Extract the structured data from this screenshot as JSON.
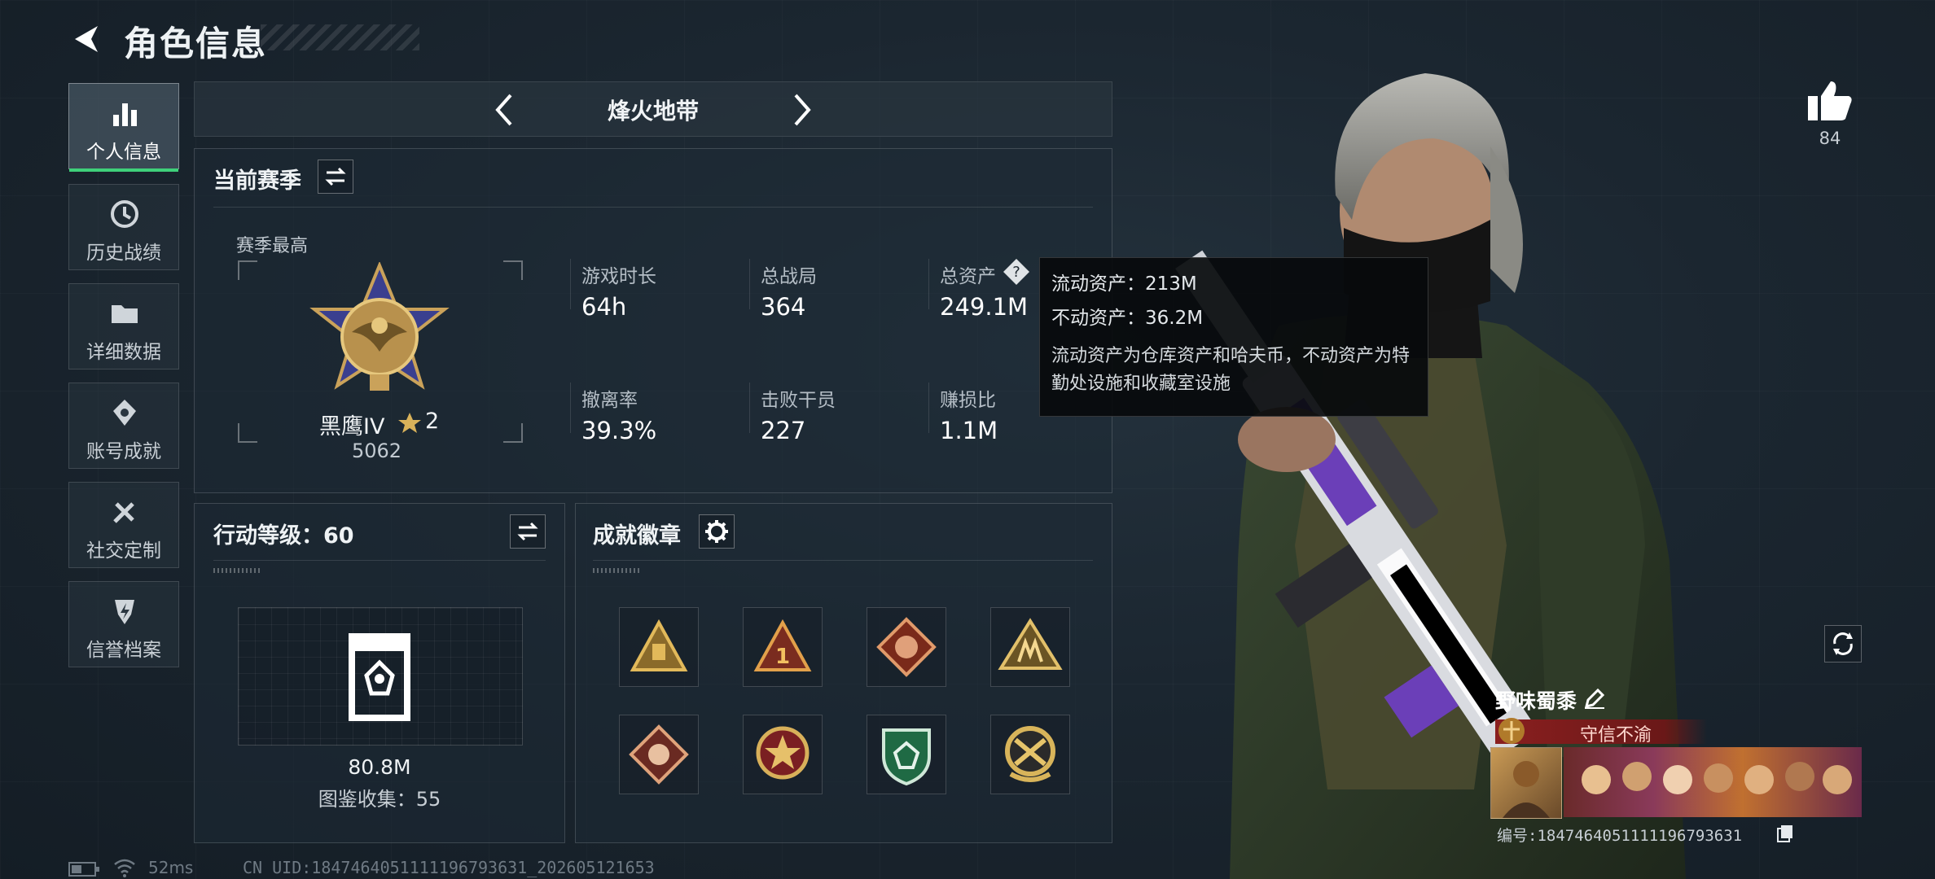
{
  "header": {
    "title": "角色信息"
  },
  "sidebar": {
    "items": [
      {
        "label": "个人信息",
        "icon": "bar-chart-icon",
        "active": true
      },
      {
        "label": "历史战绩",
        "icon": "clock-icon",
        "active": false
      },
      {
        "label": "详细数据",
        "icon": "folder-icon",
        "active": false
      },
      {
        "label": "账号成就",
        "icon": "medal-icon",
        "active": false
      },
      {
        "label": "社交定制",
        "icon": "tools-icon",
        "active": false
      },
      {
        "label": "信誉档案",
        "icon": "shield-bolt-icon",
        "active": false
      }
    ]
  },
  "mode": {
    "title": "烽火地带"
  },
  "season": {
    "title": "当前赛季",
    "best_label": "赛季最高",
    "rank_name": "黑鹰IV",
    "rank_stars": "2",
    "rank_score": "5062",
    "stats": [
      {
        "label": "游戏时长",
        "value": "64h"
      },
      {
        "label": "总战局",
        "value": "364"
      },
      {
        "label": "总资产",
        "value": "249.1M"
      },
      {
        "label": "撤离率",
        "value": "39.3%"
      },
      {
        "label": "击败干员",
        "value": "227"
      },
      {
        "label": "赚损比",
        "value": "1.1M"
      }
    ]
  },
  "tooltip": {
    "liquid": "流动资产：213M",
    "fixed": "不动资产：36.2M",
    "desc": "流动资产为仓库资产和哈夫币，不动资产为特勤处设施和收藏室设施"
  },
  "action": {
    "title": "行动等级：60",
    "value": "80.8M",
    "collection": "图鉴收集：55"
  },
  "badges": {
    "title": "成就徽章"
  },
  "likes": {
    "count": "84"
  },
  "player": {
    "name": "野味蜀黍",
    "title_badge": "守信不渝",
    "id_text": "编号:1847464051111196793631"
  },
  "footer": {
    "ping": "52ms",
    "uid": "CN UID:1847464051111196793631_202605121653"
  },
  "colors": {
    "accent": "#3fd07a",
    "title_badge_bg": "#8a1f1f"
  }
}
